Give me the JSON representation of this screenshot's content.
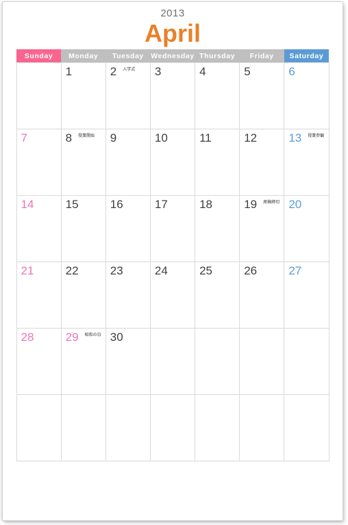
{
  "header": {
    "year": "2013",
    "month": "April"
  },
  "colors": {
    "month_title": "#E8812A",
    "year_text": "#6E6E6E",
    "sunday_header_bg": "#F9658F",
    "weekday_header_bg": "#BFBFBF",
    "saturday_header_bg": "#5B9BD5",
    "sunday_number": "#EE74B8",
    "saturday_number": "#5B9BD5",
    "weekday_number": "#3F3F3F",
    "grid_border": "#D9D9D9",
    "page_background": "#FFFFFF"
  },
  "weekday_headers": [
    {
      "label": "Sunday",
      "kind": "sun"
    },
    {
      "label": "Monday",
      "kind": "weekday"
    },
    {
      "label": "Tuesday",
      "kind": "weekday"
    },
    {
      "label": "Wednesday",
      "kind": "weekday"
    },
    {
      "label": "Thursday",
      "kind": "weekday"
    },
    {
      "label": "Friday",
      "kind": "weekday"
    },
    {
      "label": "Saturday",
      "kind": "sat"
    }
  ],
  "weeks": [
    [
      {
        "day": "",
        "note": "",
        "kind": "empty"
      },
      {
        "day": "1",
        "note": "",
        "kind": "weekday"
      },
      {
        "day": "2",
        "note": "入学式",
        "kind": "weekday"
      },
      {
        "day": "3",
        "note": "",
        "kind": "weekday"
      },
      {
        "day": "4",
        "note": "",
        "kind": "weekday"
      },
      {
        "day": "5",
        "note": "",
        "kind": "weekday"
      },
      {
        "day": "6",
        "note": "",
        "kind": "sat"
      }
    ],
    [
      {
        "day": "7",
        "note": "",
        "kind": "sun"
      },
      {
        "day": "8",
        "note": "授業開始",
        "kind": "weekday"
      },
      {
        "day": "9",
        "note": "",
        "kind": "weekday"
      },
      {
        "day": "10",
        "note": "",
        "kind": "weekday"
      },
      {
        "day": "11",
        "note": "",
        "kind": "weekday"
      },
      {
        "day": "12",
        "note": "",
        "kind": "weekday"
      },
      {
        "day": "13",
        "note": "授業参観",
        "kind": "sat"
      }
    ],
    [
      {
        "day": "14",
        "note": "",
        "kind": "sun"
      },
      {
        "day": "15",
        "note": "",
        "kind": "weekday"
      },
      {
        "day": "16",
        "note": "",
        "kind": "weekday"
      },
      {
        "day": "17",
        "note": "",
        "kind": "weekday"
      },
      {
        "day": "18",
        "note": "",
        "kind": "weekday"
      },
      {
        "day": "19",
        "note": "原稿締切",
        "kind": "weekday"
      },
      {
        "day": "20",
        "note": "",
        "kind": "sat"
      }
    ],
    [
      {
        "day": "21",
        "note": "",
        "kind": "sun"
      },
      {
        "day": "22",
        "note": "",
        "kind": "weekday"
      },
      {
        "day": "23",
        "note": "",
        "kind": "weekday"
      },
      {
        "day": "24",
        "note": "",
        "kind": "weekday"
      },
      {
        "day": "25",
        "note": "",
        "kind": "weekday"
      },
      {
        "day": "26",
        "note": "",
        "kind": "weekday"
      },
      {
        "day": "27",
        "note": "",
        "kind": "sat"
      }
    ],
    [
      {
        "day": "28",
        "note": "",
        "kind": "sun"
      },
      {
        "day": "29",
        "note": "昭和の日",
        "kind": "holiday"
      },
      {
        "day": "30",
        "note": "",
        "kind": "weekday"
      },
      {
        "day": "",
        "note": "",
        "kind": "empty"
      },
      {
        "day": "",
        "note": "",
        "kind": "empty"
      },
      {
        "day": "",
        "note": "",
        "kind": "empty"
      },
      {
        "day": "",
        "note": "",
        "kind": "empty"
      }
    ],
    [
      {
        "day": "",
        "note": "",
        "kind": "empty"
      },
      {
        "day": "",
        "note": "",
        "kind": "empty"
      },
      {
        "day": "",
        "note": "",
        "kind": "empty"
      },
      {
        "day": "",
        "note": "",
        "kind": "empty"
      },
      {
        "day": "",
        "note": "",
        "kind": "empty"
      },
      {
        "day": "",
        "note": "",
        "kind": "empty"
      },
      {
        "day": "",
        "note": "",
        "kind": "empty"
      }
    ]
  ]
}
